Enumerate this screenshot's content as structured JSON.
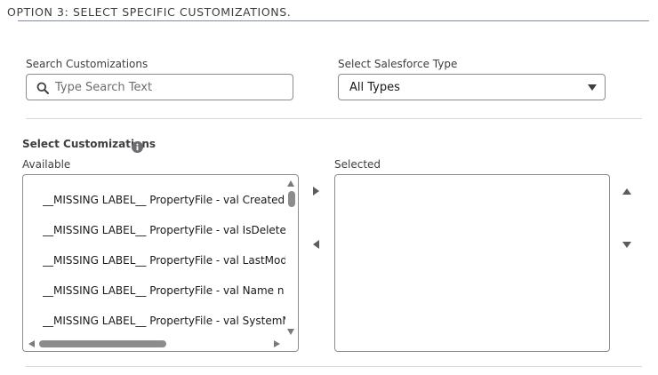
{
  "section": {
    "title": "OPTION 3: SELECT SPECIFIC CUSTOMIZATIONS."
  },
  "search": {
    "label": "Search Customizations",
    "placeholder": "Type Search Text",
    "value": "",
    "icon": "search-icon"
  },
  "type_filter": {
    "label": "Select Salesforce Type",
    "value": "All Types",
    "icon": "chevron-down-icon"
  },
  "customizations": {
    "title": "Select Customizations",
    "info_icon": "info-icon",
    "available_label": "Available",
    "selected_label": "Selected",
    "available_items": [
      "__MISSING LABEL__ PropertyFile - val CreatedById",
      "__MISSING LABEL__ PropertyFile - val IsDeleted",
      "__MISSING LABEL__ PropertyFile - val LastModifiedById",
      "__MISSING LABEL__ PropertyFile - val Name n",
      "__MISSING LABEL__ PropertyFile - val SystemModstamp"
    ],
    "selected_items": []
  },
  "colors": {
    "text": "#3e3e3c",
    "border": "#8c8c8c",
    "section_rule": "#7f8da0",
    "divider": "#d8d8d8"
  }
}
